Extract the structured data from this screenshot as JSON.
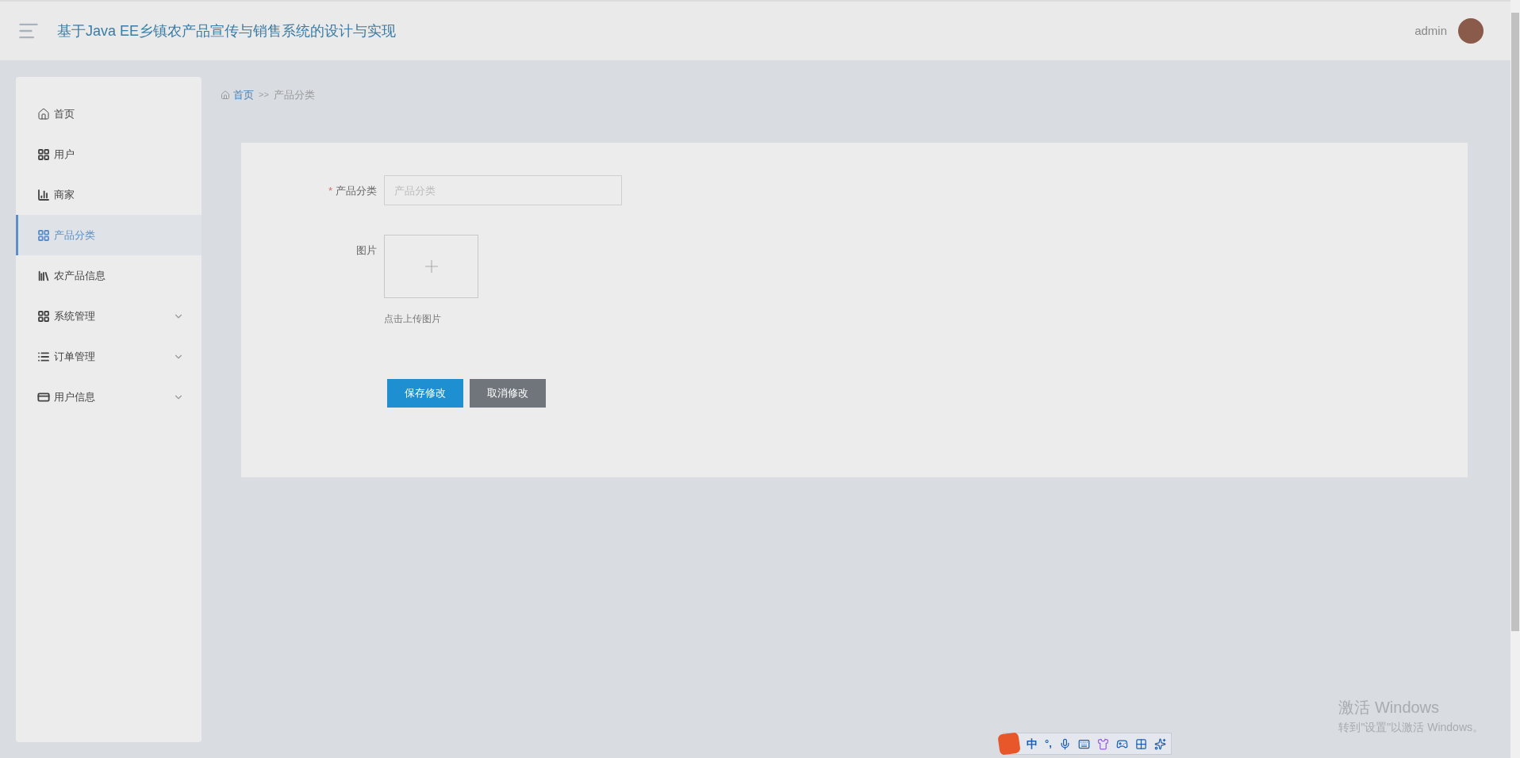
{
  "header": {
    "title": "基于Java EE乡镇农产品宣传与销售系统的设计与实现",
    "user": "admin"
  },
  "sidebar": {
    "items": [
      {
        "label": "首页",
        "expandable": false,
        "selected": false
      },
      {
        "label": "用户",
        "expandable": false,
        "selected": false
      },
      {
        "label": "商家",
        "expandable": false,
        "selected": false
      },
      {
        "label": "产品分类",
        "expandable": false,
        "selected": true
      },
      {
        "label": "农产品信息",
        "expandable": false,
        "selected": false
      },
      {
        "label": "系统管理",
        "expandable": true,
        "selected": false
      },
      {
        "label": "订单管理",
        "expandable": true,
        "selected": false
      },
      {
        "label": "用户信息",
        "expandable": true,
        "selected": false
      }
    ]
  },
  "breadcrumb": {
    "home": "首页",
    "separator": ">>",
    "current": "产品分类"
  },
  "form": {
    "fields": [
      {
        "kind": "text",
        "label": "产品分类",
        "required_mark": "*",
        "placeholder": "产品分类"
      },
      {
        "kind": "upload",
        "label": "图片",
        "hint": "点击上传图片"
      }
    ],
    "buttons": [
      {
        "label": "保存修改",
        "kind": "primary"
      },
      {
        "label": "取消修改",
        "kind": "secondary"
      }
    ]
  },
  "activation": {
    "title": "激活 Windows",
    "subtitle": "转到\"设置\"以激活 Windows。"
  },
  "ime_bar": {
    "mode": "中",
    "punctuation": "°,"
  }
}
